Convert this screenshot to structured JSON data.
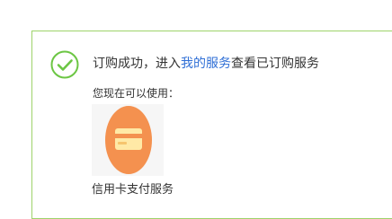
{
  "result": {
    "prefix": "订购成功，进入",
    "link_text": "我的服务",
    "suffix": "查看已订购服务",
    "icon": "check-circle-icon",
    "accent_color": "#6cc644"
  },
  "available": {
    "label": "您现在可以使用：",
    "services": [
      {
        "name": "信用卡支付服务",
        "icon": "credit-card-icon",
        "badge_color": "#f4914f",
        "card_color": "#ffe9a6"
      }
    ]
  },
  "colors": {
    "border": "#9ed36a",
    "link": "#2f6fd6",
    "text": "#333333"
  }
}
